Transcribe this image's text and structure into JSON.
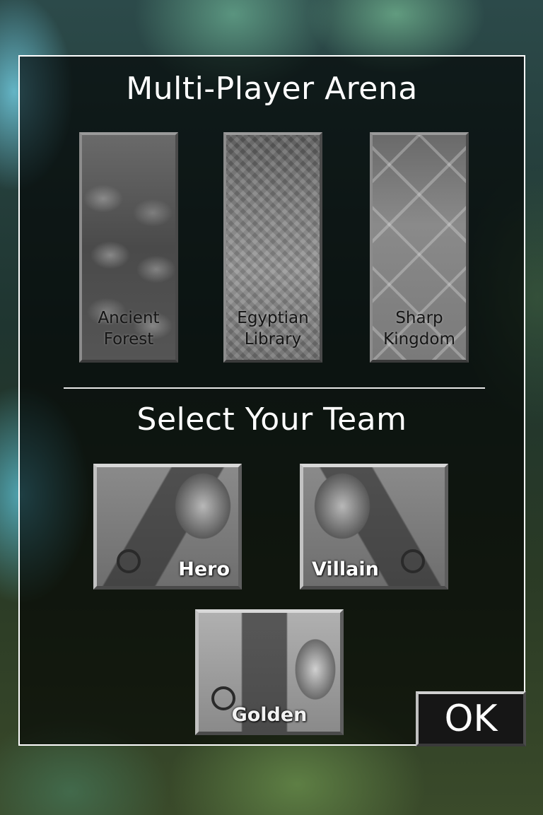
{
  "arena": {
    "title": "Multi-Player Arena",
    "maps": [
      {
        "line1": "Ancient",
        "line2": "Forest"
      },
      {
        "line1": "Egyptian",
        "line2": "Library"
      },
      {
        "line1": "Sharp",
        "line2": "Kingdom"
      }
    ]
  },
  "team": {
    "title": "Select Your Team",
    "options": [
      {
        "label": "Hero"
      },
      {
        "label": "Villain"
      },
      {
        "label": "Golden"
      }
    ]
  },
  "ok_label": "OK"
}
